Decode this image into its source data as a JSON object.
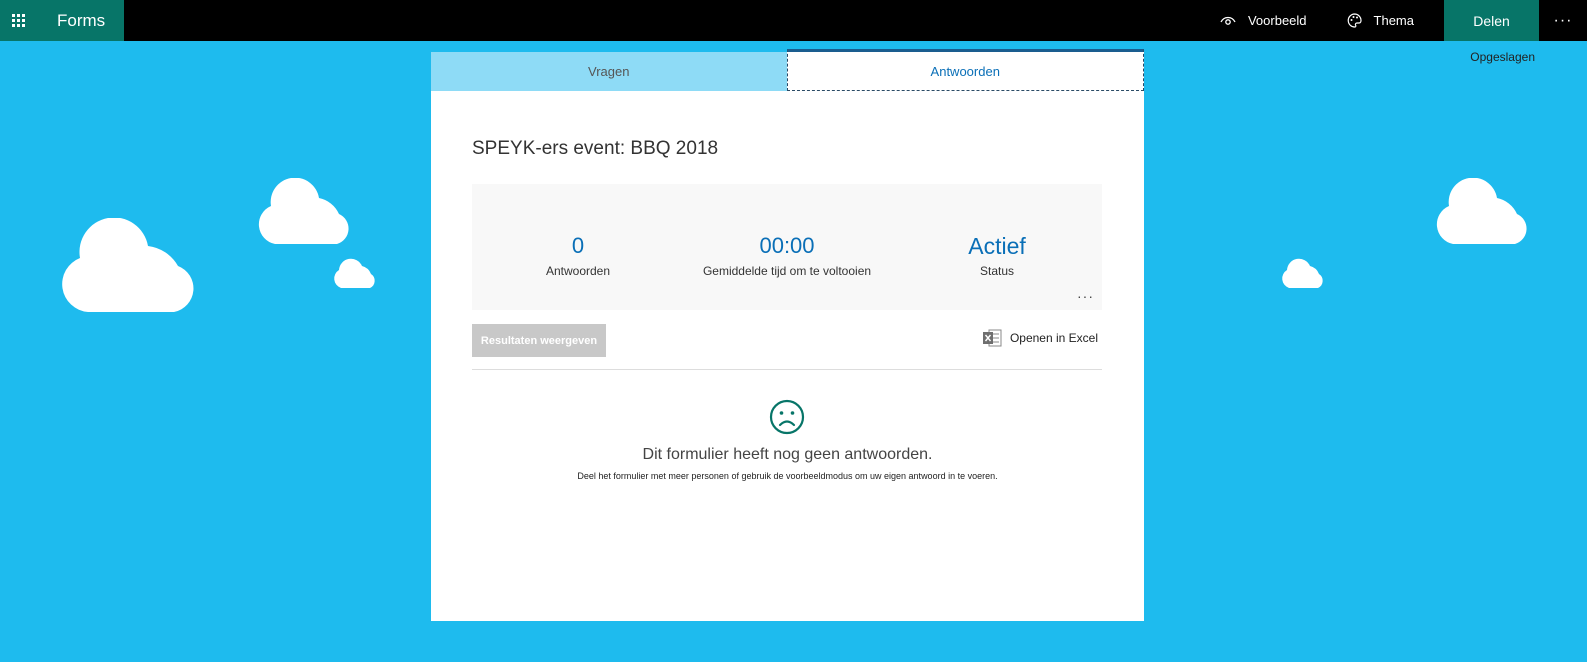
{
  "app": {
    "name": "Forms"
  },
  "toolbar": {
    "preview_label": "Voorbeeld",
    "theme_label": "Thema",
    "share_label": "Delen",
    "more_label": "···",
    "saved_status": "Opgeslagen"
  },
  "tabs": [
    {
      "label": "Vragen",
      "active": false
    },
    {
      "label": "Antwoorden",
      "active": true
    }
  ],
  "form": {
    "title": "SPEYK-ers event: BBQ 2018"
  },
  "stats": {
    "responses": {
      "value": "0",
      "label": "Antwoorden"
    },
    "avg_time": {
      "value": "00:00",
      "label": "Gemiddelde tijd om te voltooien"
    },
    "status": {
      "value": "Actief",
      "label": "Status"
    },
    "more_label": "···"
  },
  "actions": {
    "view_results_label": "Resultaten weergeven",
    "open_excel_label": "Openen in Excel"
  },
  "empty_state": {
    "icon": "sad-face-icon",
    "title": "Dit formulier heeft nog geen antwoorden.",
    "subtitle": "Deel het formulier met meer personen of gebruik de voorbeeldmodus om uw eigen antwoord in te voeren."
  },
  "colors": {
    "background": "#1ebbee",
    "brand": "#077568",
    "accent": "#0a6fb7",
    "topbar": "#000000"
  }
}
